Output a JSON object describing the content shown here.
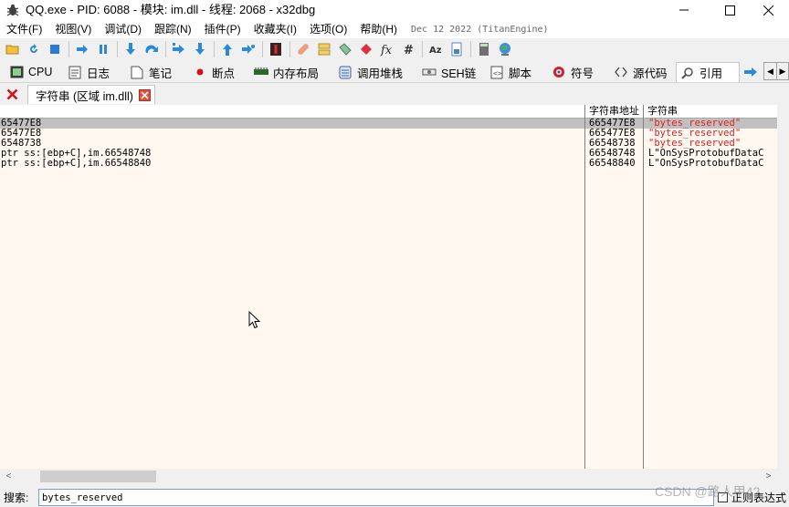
{
  "window": {
    "title": "QQ.exe - PID: 6088 - 模块: im.dll - 线程: 2068 - x32dbg"
  },
  "menu": {
    "items": [
      "文件(F)",
      "视图(V)",
      "调试(D)",
      "跟踪(N)",
      "插件(P)",
      "收藏夹(I)",
      "选项(O)",
      "帮助(H)"
    ],
    "build_date": "Dec 12 2022 (TitanEngine)"
  },
  "tabs": [
    {
      "label": "CPU",
      "icon": "cpu-icon"
    },
    {
      "label": "日志",
      "icon": "log-icon"
    },
    {
      "label": "笔记",
      "icon": "notes-icon"
    },
    {
      "label": "断点",
      "icon": "breakpoint-icon"
    },
    {
      "label": "内存布局",
      "icon": "memory-map-icon"
    },
    {
      "label": "调用堆栈",
      "icon": "call-stack-icon"
    },
    {
      "label": "SEH链",
      "icon": "seh-chain-icon"
    },
    {
      "label": "脚本",
      "icon": "script-icon"
    },
    {
      "label": "符号",
      "icon": "symbols-icon"
    },
    {
      "label": "源代码",
      "icon": "source-icon"
    },
    {
      "label": "引用",
      "icon": "references-icon",
      "active": true
    }
  ],
  "subtab": {
    "label": "字符串 (区域 im.dll)"
  },
  "table": {
    "columns": [
      "",
      "字符串地址",
      "字符串"
    ],
    "rows": [
      {
        "disasm": "65477E8",
        "address": "665477E8",
        "string": "\"bytes_reserved\"",
        "color": "#e02020",
        "selected": true
      },
      {
        "disasm": "65477E8",
        "address": "665477E8",
        "string": "\"bytes_reserved\"",
        "color": "#e02020",
        "selected": false
      },
      {
        "disasm": "6548738",
        "address": "66548738",
        "string": "\"bytes_reserved\"",
        "color": "#e02020",
        "selected": false
      },
      {
        "disasm": " ptr ss:[ebp+C],im.66548748",
        "address": "66548748",
        "string": "L\"OnSysProtobufDataC",
        "color": "#000000",
        "selected": false
      },
      {
        "disasm": " ptr ss:[ebp+C],im.66548840",
        "address": "66548840",
        "string": "L\"OnSysProtobufDataC",
        "color": "#000000",
        "selected": false
      }
    ]
  },
  "search": {
    "label": "搜索:",
    "value": "bytes_reserved",
    "regex_label": "正则表达式"
  },
  "watermark": "CSDN @路人甲42"
}
